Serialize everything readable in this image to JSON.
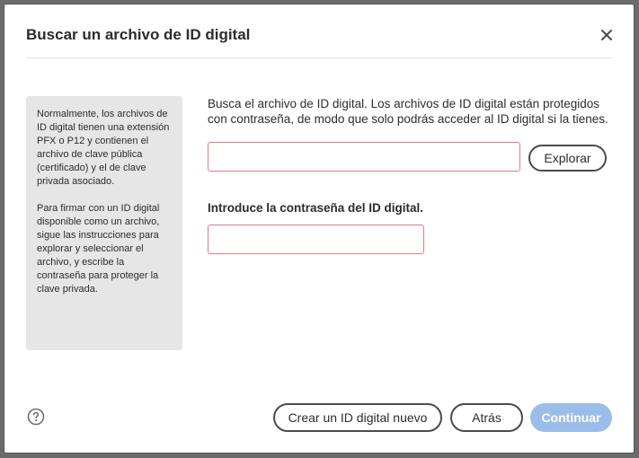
{
  "dialog": {
    "title": "Buscar un archivo de ID digital",
    "info": [
      "Normalmente, los archivos de ID digital tienen una extensión PFX o P12 y contienen el archivo de clave pública (certificado) y el de clave privada asociado.",
      "Para firmar con un ID digital disponible como un archivo, sigue las instrucciones para explorar y seleccionar el archivo, y escribe la contraseña para proteger la clave privada."
    ],
    "description": "Busca el archivo de ID digital. Los archivos de ID digital están protegidos con contraseña, de modo que solo podrás acceder al ID digital si la tienes.",
    "browse_label": "Explorar",
    "password_label": "Introduce la contraseña del ID digital.",
    "file_value": "",
    "password_value": "",
    "create_label": "Crear un ID digital nuevo",
    "back_label": "Atrás",
    "continue_label": "Continuar"
  },
  "icons": {
    "close": "close-icon",
    "help": "help-icon"
  },
  "colors": {
    "input_error_border": "#e47a7a",
    "primary_disabled": "#9bbde9",
    "info_panel_bg": "#e6e6e6"
  }
}
